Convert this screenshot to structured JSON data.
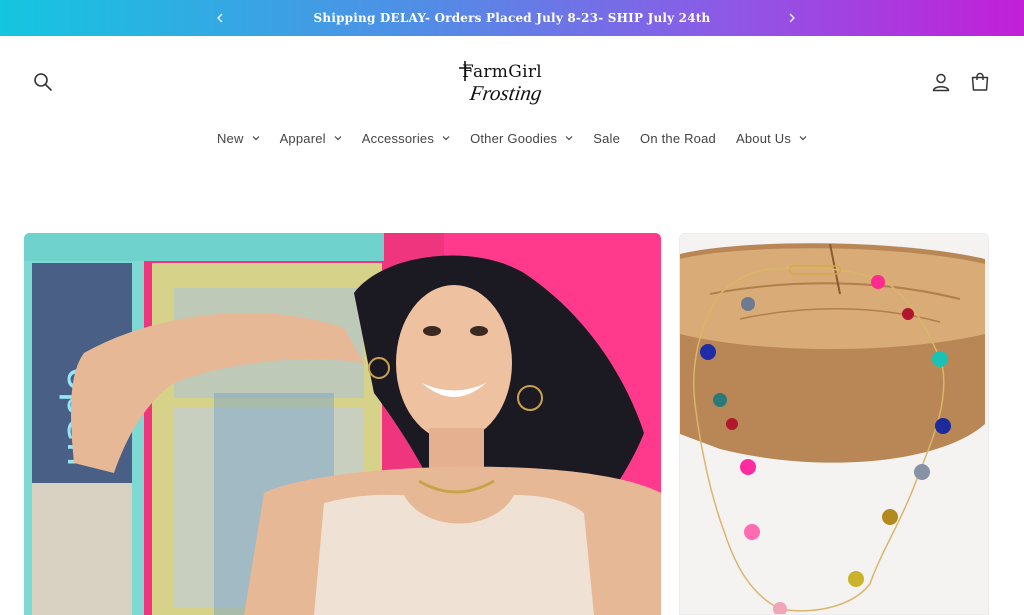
{
  "announcement": {
    "text": "Shipping DELAY- Orders Placed July 8-23- SHIP July 24th",
    "prev_icon": "chevron-left-icon",
    "next_icon": "chevron-right-icon",
    "gradient": [
      "#14c6e0",
      "#4f8fe6",
      "#8b5be6",
      "#c21fd8"
    ]
  },
  "header": {
    "logo": {
      "line1": "FarmGirl",
      "line2": "Frosting"
    },
    "icons": {
      "search": "search-icon",
      "account": "user-icon",
      "cart": "cart-icon"
    }
  },
  "nav": {
    "items": [
      {
        "label": "New",
        "dropdown": true
      },
      {
        "label": "Apparel",
        "dropdown": true
      },
      {
        "label": "Accessories",
        "dropdown": true
      },
      {
        "label": "Other Goodies",
        "dropdown": true
      },
      {
        "label": "Sale",
        "dropdown": false
      },
      {
        "label": "On the Road",
        "dropdown": false
      },
      {
        "label": "About Us",
        "dropdown": true
      }
    ]
  }
}
